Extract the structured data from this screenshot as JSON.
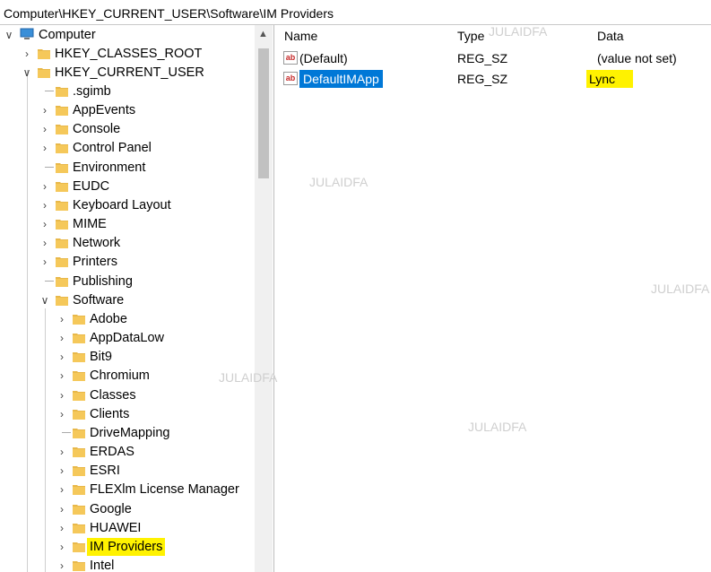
{
  "address_bar": "Computer\\HKEY_CURRENT_USER\\Software\\IM Providers",
  "tree": {
    "computer": "Computer",
    "hives": [
      "HKEY_CLASSES_ROOT",
      "HKEY_CURRENT_USER"
    ],
    "hkcu_children": [
      ".sgimb",
      "AppEvents",
      "Console",
      "Control Panel",
      "Environment",
      "EUDC",
      "Keyboard Layout",
      "MIME",
      "Network",
      "Printers",
      "Publishing",
      "Software"
    ],
    "software_children": [
      "Adobe",
      "AppDataLow",
      "Bit9",
      "Chromium",
      "Classes",
      "Clients",
      "DriveMapping",
      "ERDAS",
      "ESRI",
      "FLEXlm License Manager",
      "Google",
      "HUAWEI",
      "IM Providers",
      "Intel"
    ],
    "selected": "IM Providers"
  },
  "columns": {
    "name": "Name",
    "type": "Type",
    "data": "Data"
  },
  "values": [
    {
      "name": "(Default)",
      "type": "REG_SZ",
      "data": "(value not set)"
    },
    {
      "name": "DefaultIMApp",
      "type": "REG_SZ",
      "data": "Lync"
    }
  ],
  "icons": {
    "value": "ab",
    "folder": "folder-icon",
    "computer": "computer-icon"
  },
  "colors": {
    "selection": "#0078d7",
    "highlight": "#fff200",
    "folder": "#e8b84a"
  },
  "watermark": "JULAIDFA"
}
